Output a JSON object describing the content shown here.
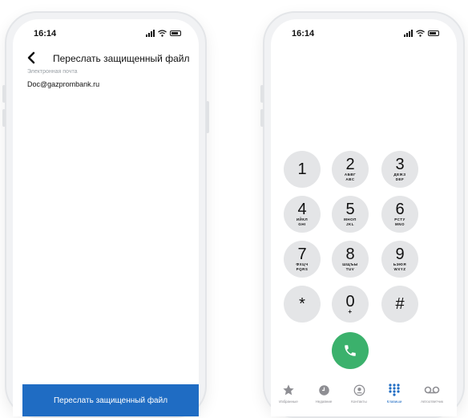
{
  "left_phone": {
    "status": {
      "time": "16:14"
    },
    "nav": {
      "title": "Переслать защищенный файл"
    },
    "field": {
      "label": "Электронная почта",
      "value": "Doc@gazprombank.ru"
    },
    "primary_button": {
      "label": "Переслать защищенный файл",
      "color": "#1f6cc3"
    }
  },
  "right_phone": {
    "status": {
      "time": "16:14"
    },
    "keys": [
      {
        "digit": "1",
        "letters_ru": "",
        "letters_en": ""
      },
      {
        "digit": "2",
        "letters_ru": "АБВГ",
        "letters_en": "ABC"
      },
      {
        "digit": "3",
        "letters_ru": "ДЕЖЗ",
        "letters_en": "DEF"
      },
      {
        "digit": "4",
        "letters_ru": "ИЙКЛ",
        "letters_en": "GHI"
      },
      {
        "digit": "5",
        "letters_ru": "МНОП",
        "letters_en": "JKL"
      },
      {
        "digit": "6",
        "letters_ru": "РСТУ",
        "letters_en": "MNO"
      },
      {
        "digit": "7",
        "letters_ru": "ФХЦЧ",
        "letters_en": "PQRS"
      },
      {
        "digit": "8",
        "letters_ru": "ШЩЪЫ",
        "letters_en": "TUV"
      },
      {
        "digit": "9",
        "letters_ru": "ЬЭЮЯ",
        "letters_en": "WXYZ"
      },
      {
        "digit": "*",
        "letters_ru": "",
        "letters_en": ""
      },
      {
        "digit": "0",
        "letters_ru": "+",
        "letters_en": ""
      },
      {
        "digit": "#",
        "letters_ru": "",
        "letters_en": ""
      }
    ],
    "call_button": {
      "icon": "phone-icon",
      "color": "#3bb16c"
    },
    "tabs": [
      {
        "label": "Избранные",
        "icon": "star-icon",
        "active": false
      },
      {
        "label": "Недавние",
        "icon": "clock-icon",
        "active": false
      },
      {
        "label": "Контакты",
        "icon": "contact-icon",
        "active": false
      },
      {
        "label": "Клавиши",
        "icon": "keypad-icon",
        "active": true
      },
      {
        "label": "Автоответчик",
        "icon": "voicemail-icon",
        "active": false
      }
    ],
    "accent_color": "#1f6cc3"
  }
}
